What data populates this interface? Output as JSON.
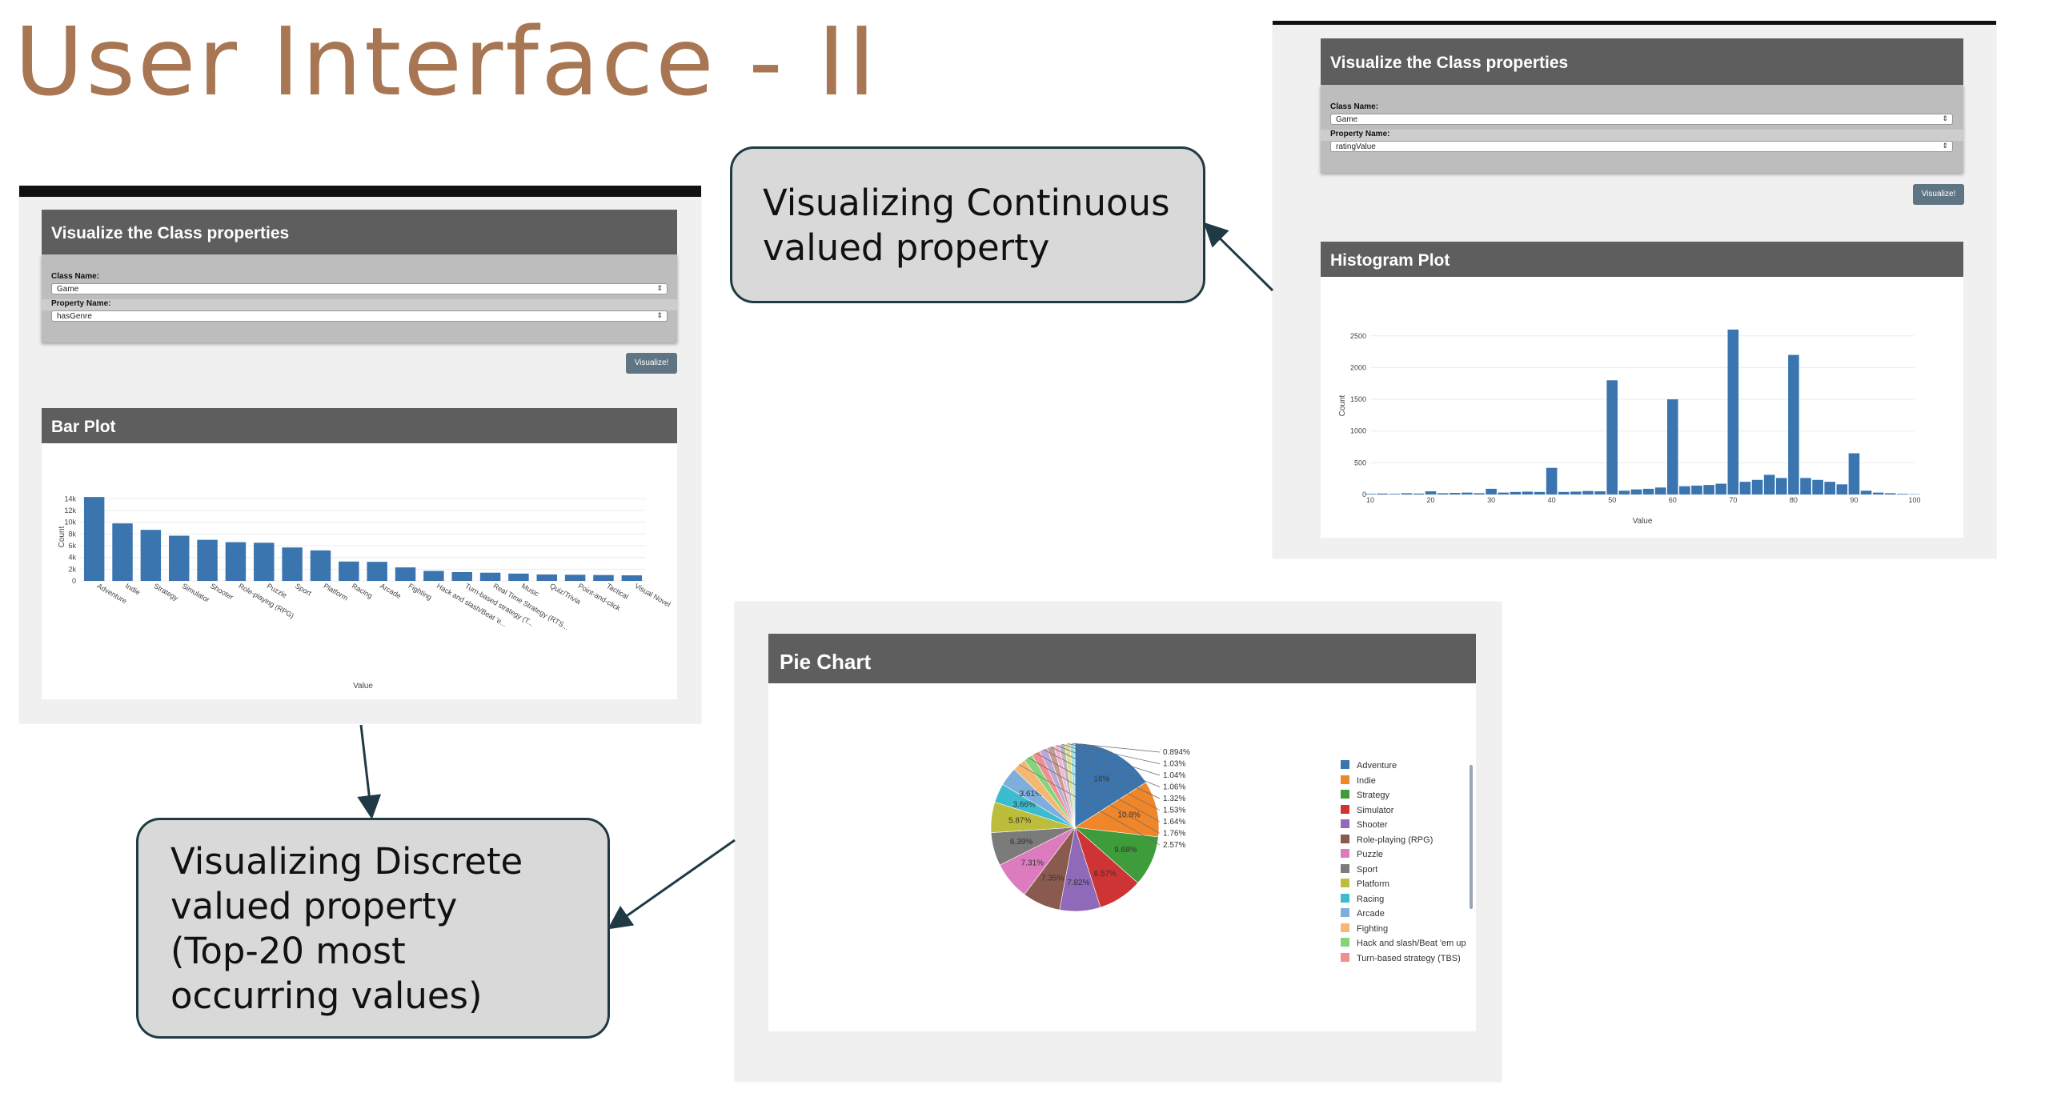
{
  "slide": {
    "title": "User Interface - II"
  },
  "callouts": {
    "continuous": [
      "Visualizing Continuous",
      "valued property"
    ],
    "discrete": [
      "Visualizing Discrete",
      "valued property",
      "(Top-20 most",
      "occurring values)"
    ]
  },
  "form_left": {
    "panel_title": "Visualize the Class properties",
    "class_label": "Class Name:",
    "class_value": "Game",
    "property_label": "Property Name:",
    "property_value": "hasGenre",
    "button_label": "Visualize!"
  },
  "form_right": {
    "panel_title": "Visualize the Class properties",
    "class_label": "Class Name:",
    "class_value": "Game",
    "property_label": "Property Name:",
    "property_value": "ratingValue",
    "button_label": "Visualize!"
  },
  "bar_panel": {
    "title": "Bar Plot"
  },
  "hist_panel": {
    "title": "Histogram Plot"
  },
  "pie_panel": {
    "title": "Pie Chart"
  },
  "icons": {
    "select_arrow": "updown-arrow-icon"
  },
  "colors": {
    "title": "#a87652",
    "bar": "#3a75b0",
    "panel_header": "#5e5e5e",
    "callout_fill": "#d9d9d9",
    "callout_border": "#1f3a44"
  },
  "chart_data": [
    {
      "type": "bar",
      "categories": [
        "Adventure",
        "Indie",
        "Strategy",
        "Simulator",
        "Shooter",
        "Role-playing (RPG)",
        "Puzzle",
        "Sport",
        "Platform",
        "Racing",
        "Arcade",
        "Fighting",
        "Hack and slash/Beat 'em up",
        "Turn-based strategy (TBS)",
        "Real Time Strategy (RTS)",
        "Music",
        "Quiz/Trivia",
        "Point-and-click",
        "Tactical",
        "Visual Novel"
      ],
      "tick_labels": [
        "Adventure",
        "Indie",
        "Strategy",
        "Simulator",
        "Shooter",
        "Role-playing (RPG)",
        "Puzzle",
        "Sport",
        "Platform",
        "Racing",
        "Arcade",
        "Fighting",
        "Hack and slash/Beat 'e...",
        "Turn-based strategy (T...",
        "Real Time Strategy (RTS...",
        "Music",
        "Quiz/Trivia",
        "Point-and-click",
        "Tactical",
        "Visual Novel"
      ],
      "values": [
        14300,
        9800,
        8700,
        7700,
        7000,
        6600,
        6500,
        5700,
        5200,
        3300,
        3250,
        2300,
        1700,
        1500,
        1400,
        1250,
        1100,
        1050,
        1000,
        950
      ],
      "xlabel": "Value",
      "ylabel": "Count",
      "ylim": [
        0,
        15000
      ],
      "yticks": [
        0,
        2000,
        4000,
        6000,
        8000,
        10000,
        12000,
        14000
      ],
      "ytick_labels": [
        "0",
        "2k",
        "4k",
        "6k",
        "8k",
        "10k",
        "12k",
        "14k"
      ],
      "grid": true
    },
    {
      "type": "bar",
      "x": [
        10,
        12,
        14,
        16,
        18,
        20,
        22,
        24,
        26,
        28,
        30,
        32,
        34,
        36,
        38,
        40,
        42,
        44,
        46,
        48,
        50,
        52,
        54,
        56,
        58,
        60,
        62,
        64,
        66,
        68,
        70,
        72,
        74,
        76,
        78,
        80,
        82,
        84,
        86,
        88,
        90,
        92,
        94,
        96,
        98,
        100
      ],
      "values": [
        10,
        15,
        10,
        20,
        15,
        50,
        20,
        25,
        30,
        20,
        90,
        30,
        40,
        45,
        40,
        420,
        40,
        45,
        55,
        50,
        1800,
        60,
        80,
        90,
        110,
        1500,
        130,
        140,
        150,
        170,
        2600,
        200,
        230,
        310,
        260,
        2200,
        260,
        230,
        200,
        160,
        650,
        60,
        30,
        20,
        10,
        5
      ],
      "xlabel": "Value",
      "ylabel": "Count",
      "xlim": [
        10,
        100
      ],
      "xticks": [
        10,
        20,
        30,
        40,
        50,
        60,
        70,
        80,
        90,
        100
      ],
      "ylim": [
        0,
        2800
      ],
      "yticks": [
        0,
        500,
        1000,
        1500,
        2000,
        2500
      ],
      "grid": true
    },
    {
      "type": "pie",
      "labels": [
        "Adventure",
        "Indie",
        "Strategy",
        "Simulator",
        "Shooter",
        "Role-playing (RPG)",
        "Puzzle",
        "Sport",
        "Platform",
        "Racing",
        "Arcade",
        "Fighting",
        "Hack and slash/Beat 'em up",
        "Turn-based strategy (TBS)",
        "Real Time Strategy (RTS)",
        "Music",
        "Quiz/Trivia",
        "Point-and-click",
        "Tactical",
        "Visual Novel"
      ],
      "text_labels": [
        "16%",
        "10.8%",
        "9.68%",
        "8.57%",
        "7.82%",
        "7.35%",
        "7.31%",
        "6.39%",
        "5.87%",
        "3.66%",
        "3.61%",
        "2.57%",
        "1.76%",
        "1.64%",
        "1.53%",
        "1.32%",
        "1.06%",
        "1.04%",
        "1.03%",
        "0.894%"
      ],
      "values": [
        16,
        10.8,
        9.68,
        8.57,
        7.82,
        7.35,
        7.31,
        6.39,
        5.87,
        3.66,
        3.61,
        2.57,
        1.76,
        1.64,
        1.53,
        1.32,
        1.06,
        1.04,
        1.03,
        0.894
      ],
      "colors": [
        "#3a75b0",
        "#f0862a",
        "#3e9c3a",
        "#cf3434",
        "#8f6ab8",
        "#8a5a4f",
        "#dc7cbf",
        "#7b7b7b",
        "#bdbd3c",
        "#3ebccf",
        "#7eaedc",
        "#f5b774",
        "#86d47a",
        "#ef8f8f",
        "#bba8d8",
        "#c69c92",
        "#f1b6d6",
        "#b8b8b8",
        "#dede95",
        "#9fe0ec"
      ],
      "legend_visible": [
        "Adventure",
        "Indie",
        "Strategy",
        "Simulator",
        "Shooter",
        "Role-playing (RPG)",
        "Puzzle",
        "Sport",
        "Platform",
        "Racing",
        "Arcade",
        "Fighting",
        "Hack and slash/Beat 'em up",
        "Turn-based strategy (TBS)"
      ],
      "legend_position": "right"
    }
  ]
}
